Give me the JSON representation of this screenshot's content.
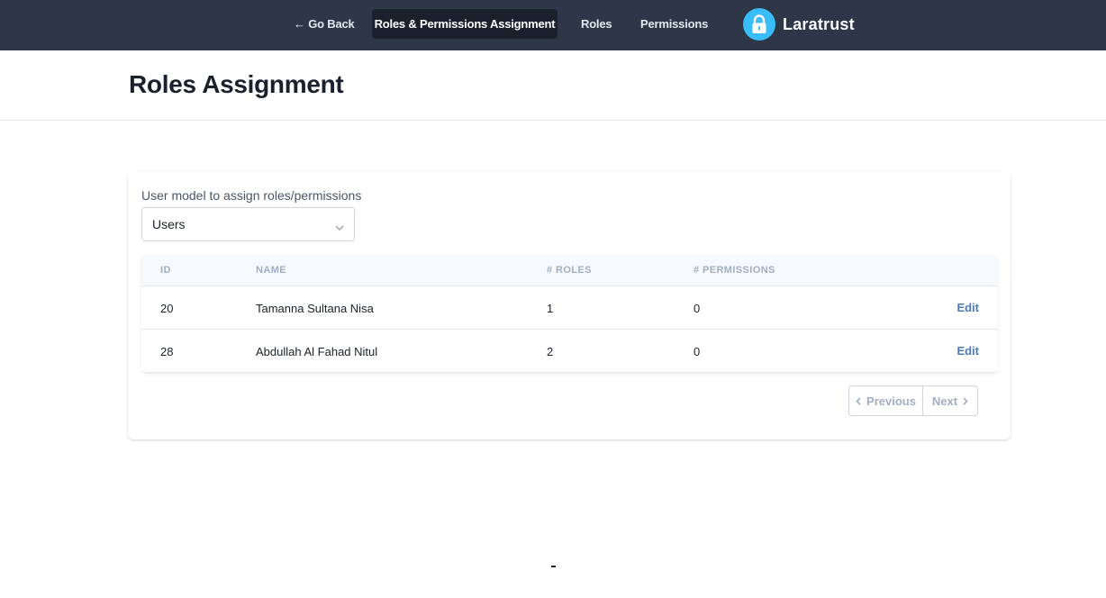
{
  "nav": {
    "back_label": "← Go Back",
    "active_label": "Roles & Permissions Assignment",
    "roles_label": "Roles",
    "permissions_label": "Permissions",
    "brand_name": "Laratrust",
    "brand_icon": "lock-icon"
  },
  "page": {
    "title": "Roles Assignment"
  },
  "form": {
    "model_label": "User model to assign roles/permissions",
    "model_selected": "Users"
  },
  "table": {
    "columns": [
      "ID",
      "NAME",
      "# ROLES",
      "# PERMISSIONS"
    ],
    "rows": [
      {
        "id": "20",
        "name": "Tamanna Sultana Nisa",
        "roles": "1",
        "permissions": "0",
        "action": "Edit"
      },
      {
        "id": "28",
        "name": "Abdullah Al Fahad Nitul",
        "roles": "2",
        "permissions": "0",
        "action": "Edit"
      }
    ]
  },
  "pagination": {
    "previous_label": "Previous",
    "next_label": "Next"
  },
  "colors": {
    "topbar": "#2d3748",
    "active_nav": "#1a202c",
    "brand_logo": "#38bdf8",
    "link": "#4c7ab3"
  }
}
